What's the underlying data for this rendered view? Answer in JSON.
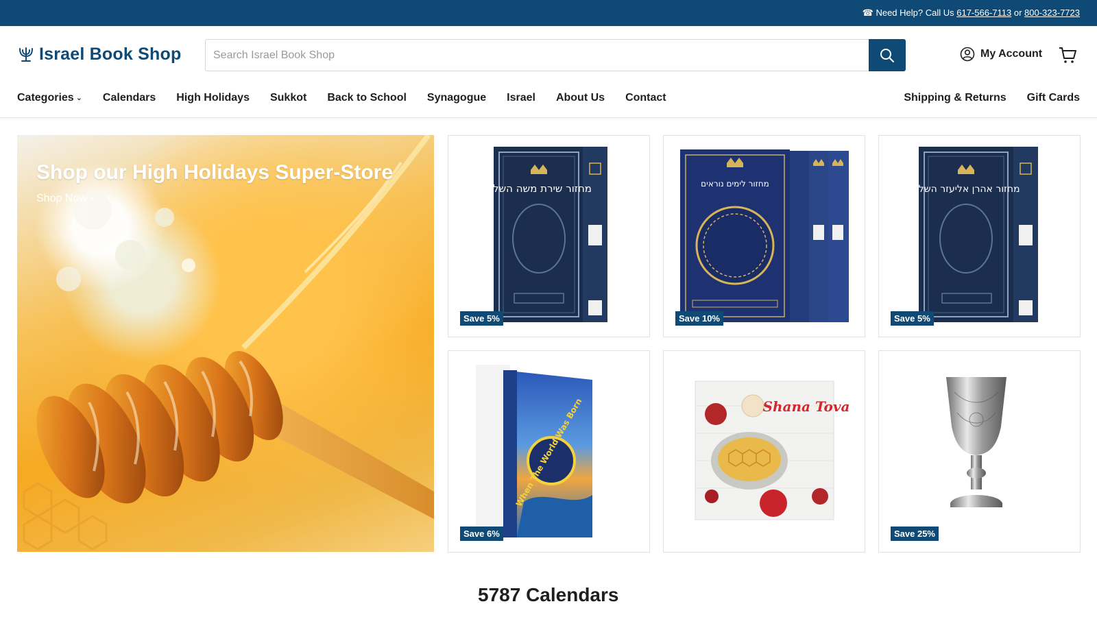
{
  "topbar": {
    "prefix": "☎ Need Help? Call Us ",
    "phone1": "617-566-7113",
    "or": " or ",
    "phone2": "800-323-7723"
  },
  "header": {
    "logo_text": "Israel Book Shop",
    "search_placeholder": "Search Israel Book Shop",
    "account_label": "My Account"
  },
  "nav": {
    "left": [
      "Categories",
      "Calendars",
      "High Holidays",
      "Sukkot",
      "Back to School",
      "Synagogue",
      "Israel",
      "About Us",
      "Contact"
    ],
    "right": [
      "Shipping & Returns",
      "Gift Cards"
    ]
  },
  "hero": {
    "title": "Shop our High Holidays Super-Store",
    "cta": "Shop Now"
  },
  "products": [
    {
      "badge": "Save 5%",
      "image": "machzor-navy-book"
    },
    {
      "badge": "Save 10%",
      "image": "machzor-navy-set"
    },
    {
      "badge": "Save 5%",
      "image": "machzor-navy-book"
    },
    {
      "badge": "Save 6%",
      "image": "when-the-world-was-born-book"
    },
    {
      "badge": "",
      "image": "shana-tova-card"
    },
    {
      "badge": "Save 25%",
      "image": "silver-kiddush-cup"
    }
  ],
  "book_titles": {
    "book1": "מחזור שירת משה השלם",
    "book2": "מחזור לימים נוראים",
    "book3": "מחזור אהרן אליעזר השלם",
    "kids_book": "When The World Was Born",
    "card": "Shana Tova"
  },
  "section": {
    "title": "5787 Calendars"
  },
  "colors": {
    "brand": "#0e4a75"
  }
}
